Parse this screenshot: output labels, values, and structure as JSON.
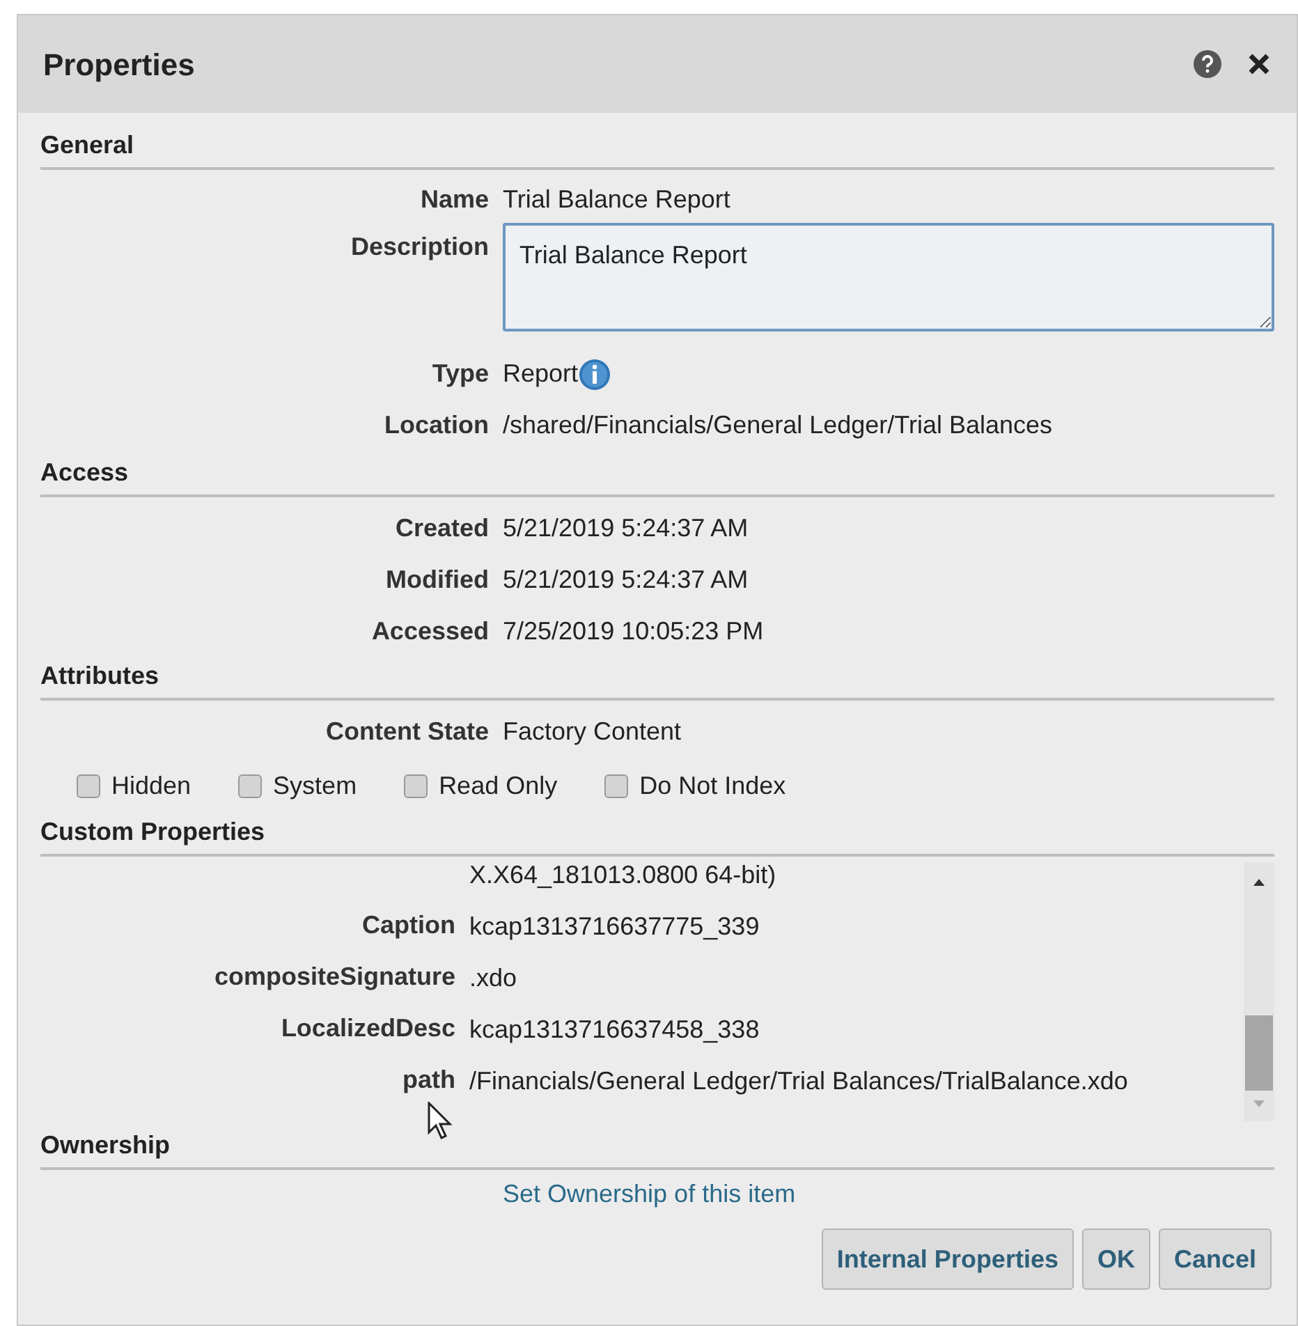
{
  "dialog": {
    "title": "Properties"
  },
  "general": {
    "heading": "General",
    "name_label": "Name",
    "name": "Trial Balance Report",
    "description_label": "Description",
    "description": "Trial Balance Report",
    "type_label": "Type",
    "type": "Report",
    "location_label": "Location",
    "location": "/shared/Financials/General Ledger/Trial Balances"
  },
  "access": {
    "heading": "Access",
    "rows": [
      {
        "label": "Created",
        "value": "5/21/2019 5:24:37 AM"
      },
      {
        "label": "Modified",
        "value": "5/21/2019 5:24:37 AM"
      },
      {
        "label": "Accessed",
        "value": "7/25/2019 10:05:23 PM"
      }
    ]
  },
  "attributes": {
    "heading": "Attributes",
    "content_state_label": "Content State",
    "content_state": "Factory Content",
    "checkboxes": [
      {
        "label": "Hidden",
        "checked": false
      },
      {
        "label": "System",
        "checked": false
      },
      {
        "label": "Read Only",
        "checked": false
      },
      {
        "label": "Do Not Index",
        "checked": false
      }
    ]
  },
  "custom_properties": {
    "heading": "Custom Properties",
    "continued_value": "X.X64_181013.0800 64-bit)",
    "rows": [
      {
        "label": "Caption",
        "value": "kcap1313716637775_339"
      },
      {
        "label": "compositeSignature",
        "value": ".xdo"
      },
      {
        "label": "LocalizedDesc",
        "value": "kcap1313716637458_338"
      },
      {
        "label": "path",
        "value": "/Financials/General Ledger/Trial Balances/TrialBalance.xdo"
      }
    ]
  },
  "ownership": {
    "heading": "Ownership",
    "link": "Set Ownership of this item"
  },
  "buttons": [
    "Internal Properties",
    "OK",
    "Cancel"
  ]
}
